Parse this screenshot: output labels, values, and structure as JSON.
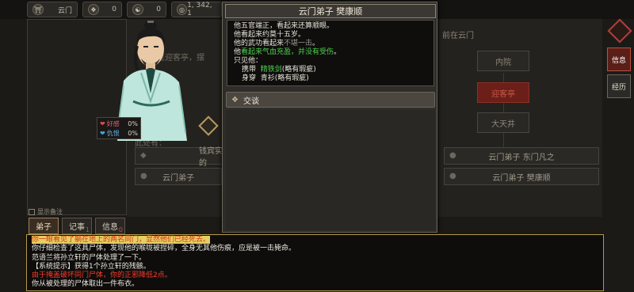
{
  "topbar": {
    "stats": [
      {
        "icon": "gate-icon",
        "glyph": "⛩",
        "label": "云门",
        "value": ""
      },
      {
        "icon": "leaf-icon",
        "glyph": "❖",
        "label": "",
        "value": "0"
      },
      {
        "icon": "yinyang-icon",
        "glyph": "☯",
        "label": "",
        "value": "0"
      },
      {
        "icon": "coin-icon",
        "glyph": "◎",
        "label": "1, 342, 1",
        "value": ""
      }
    ]
  },
  "left_panel": {
    "show_memo_label": "显示备注",
    "tabs": [
      {
        "label": "弟子",
        "badge": ""
      },
      {
        "label": "记事",
        "badge": "1"
      },
      {
        "label": "信息",
        "badge": "0"
      }
    ]
  },
  "portrait": {
    "favor_label": "好感",
    "favor_value": "0%",
    "hatred_label": "仇恨",
    "hatred_value": "0%"
  },
  "scene": {
    "greeting_text": "是迎客亭，摆",
    "current_location_text": "前在云门",
    "nearby_label": "此处有：",
    "locations": [
      "内院",
      "迎客亭",
      "大天井"
    ],
    "people": [
      {
        "name": "钱宾实的"
      },
      {
        "name": "云门弟子 东门凡之"
      },
      {
        "name": "云门弟子"
      },
      {
        "name": "云门弟子 樊康顺"
      }
    ]
  },
  "popup": {
    "title": "云门弟子  樊康顺",
    "desc": {
      "line1": "他五官端正，看起来还算顺眼。",
      "line2": "他看起来约莫十五岁。",
      "line3_prefix": "他的武功看起来",
      "line3_value": "不堪一击",
      "line3_suffix": "。",
      "line4_prefix": "他",
      "line4_green": "看起来气血充盈，并没有受伤",
      "line4_suffix": "。",
      "line5": "只见他：",
      "carry_label": "携带",
      "carry_item": "精铁剑",
      "carry_note": "(略有瑕疵)",
      "wear_label": "身穿",
      "wear_item": "青衫",
      "wear_note": "(略有瑕疵)"
    },
    "action_label": "交谈",
    "action_icon": "diamond-icon"
  },
  "side_buttons": [
    {
      "label": "信息",
      "active": true
    },
    {
      "label": "经历",
      "active": false
    }
  ],
  "log": {
    "line1_prefix": "你一眼看见了",
    "line1_highlight": "躺在地上的两名同门",
    "line1_suffix": "，显然他们已经死去。",
    "line2": "你仔细检查了这具尸体，发现他的喉咙被捏碎，全身无其他伤痕，应是被一击毙命。",
    "line3": "范语兰将孙立轩的尸体处理了一下。",
    "line4": "【系统提示】获得1个孙立轩的残骸。",
    "line5": "由于掩盖破坏同门尸体，你的正邪降低2点。",
    "line6": "你从被处理的尸体取出一件布衣。"
  },
  "colors": {
    "accent_gold": "#b59a4a",
    "highlight_red": "#6b1f18",
    "text_green": "#4fd04f",
    "log_red": "#ff3a2a"
  }
}
